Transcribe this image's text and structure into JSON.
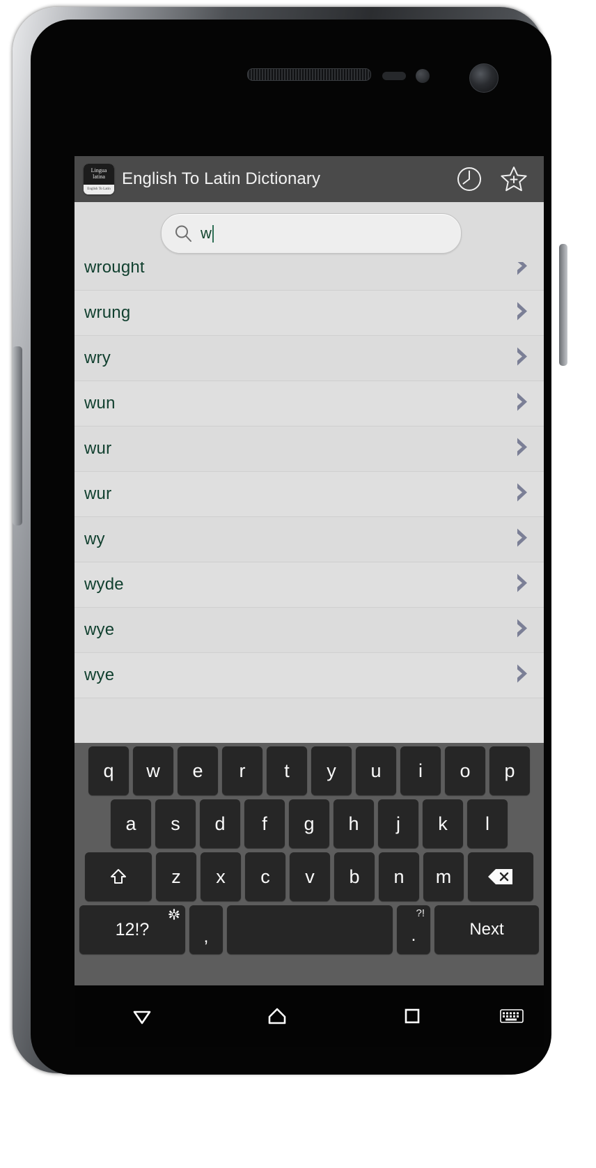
{
  "device": {
    "hardware": {
      "earpiece": "earpiece-speaker",
      "proximity_sensor": "proximity-sensor",
      "front_camera": "front-camera",
      "volume_button": "volume-rocker",
      "power_button": "power-button"
    }
  },
  "app_bar": {
    "logo": {
      "line1": "Lingua",
      "line2": "latina",
      "subtitle": "English To Latin"
    },
    "title": "English To Latin Dictionary",
    "icons": [
      {
        "name": "history-clock-icon",
        "label": "History"
      },
      {
        "name": "star-add-favorite-icon",
        "label": "Add to favorites"
      }
    ]
  },
  "search": {
    "icon": "search-icon",
    "value": "w",
    "placeholder": "Search"
  },
  "word_list": {
    "items": [
      {
        "word": "wrought",
        "chevron": "chevron-right-icon"
      },
      {
        "word": "wrung",
        "chevron": "chevron-right-icon"
      },
      {
        "word": "wry",
        "chevron": "chevron-right-icon"
      },
      {
        "word": "wun",
        "chevron": "chevron-right-icon"
      },
      {
        "word": "wur",
        "chevron": "chevron-right-icon"
      },
      {
        "word": "wur",
        "chevron": "chevron-right-icon"
      },
      {
        "word": "wy",
        "chevron": "chevron-right-icon"
      },
      {
        "word": "wyde",
        "chevron": "chevron-right-icon"
      },
      {
        "word": "wye",
        "chevron": "chevron-right-icon"
      },
      {
        "word": "wye",
        "chevron": "chevron-right-icon"
      }
    ]
  },
  "keyboard": {
    "row1": [
      "q",
      "w",
      "e",
      "r",
      "t",
      "y",
      "u",
      "i",
      "o",
      "p"
    ],
    "row2": [
      "a",
      "s",
      "d",
      "f",
      "g",
      "h",
      "j",
      "k",
      "l"
    ],
    "row3": {
      "shift": "shift-key-icon",
      "letters": [
        "z",
        "x",
        "c",
        "v",
        "b",
        "n",
        "m"
      ],
      "backspace": "backspace-key-icon"
    },
    "row4": {
      "symbols": "12!?",
      "settings_icon": "gear-icon",
      "comma": ",",
      "space": "",
      "period": ".",
      "period_sup": "?!",
      "action": "Next"
    }
  },
  "nav_bar": {
    "back": "back-triangle-icon",
    "home": "home-icon",
    "recents": "recents-square-icon",
    "keyboard": "keyboard-icon"
  },
  "colors": {
    "app_bar": "#4a4a4a",
    "screen_bg": "#dcdcdc",
    "word_text": "#11402f",
    "chevron": "#7b7f96",
    "keyboard_bg": "#5d5d5d",
    "key_bg": "#262626",
    "nav_bg": "#040404"
  }
}
